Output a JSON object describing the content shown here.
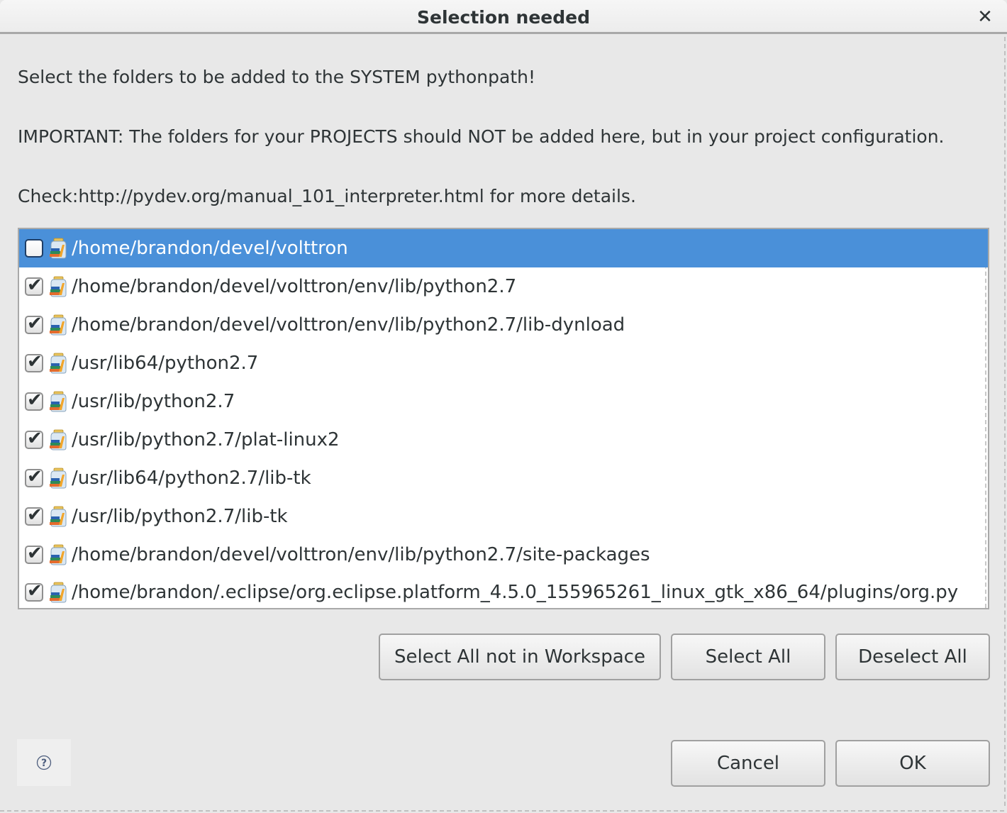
{
  "window": {
    "title": "Selection needed",
    "close_icon": "close-icon"
  },
  "messages": {
    "line1": "Select the folders to be added to the SYSTEM pythonpath!",
    "line2": "IMPORTANT: The folders for your PROJECTS should NOT be added here, but in your project configuration.",
    "line3": "Check:http://pydev.org/manual_101_interpreter.html for more details."
  },
  "folders": [
    {
      "path": "/home/brandon/devel/volttron",
      "checked": false,
      "selected": true
    },
    {
      "path": "/home/brandon/devel/volttron/env/lib/python2.7",
      "checked": true,
      "selected": false
    },
    {
      "path": "/home/brandon/devel/volttron/env/lib/python2.7/lib-dynload",
      "checked": true,
      "selected": false
    },
    {
      "path": "/usr/lib64/python2.7",
      "checked": true,
      "selected": false
    },
    {
      "path": "/usr/lib/python2.7",
      "checked": true,
      "selected": false
    },
    {
      "path": "/usr/lib/python2.7/plat-linux2",
      "checked": true,
      "selected": false
    },
    {
      "path": "/usr/lib64/python2.7/lib-tk",
      "checked": true,
      "selected": false
    },
    {
      "path": "/usr/lib/python2.7/lib-tk",
      "checked": true,
      "selected": false
    },
    {
      "path": "/home/brandon/devel/volttron/env/lib/python2.7/site-packages",
      "checked": true,
      "selected": false
    },
    {
      "path": "/home/brandon/.eclipse/org.eclipse.platform_4.5.0_155965261_linux_gtk_x86_64/plugins/org.py",
      "checked": true,
      "selected": false
    }
  ],
  "selection_buttons": {
    "select_not_in_workspace": "Select All not in Workspace",
    "select_all": "Select All",
    "deselect_all": "Deselect All"
  },
  "footer": {
    "help_icon": "help-icon",
    "cancel": "Cancel",
    "ok": "OK"
  },
  "colors": {
    "selection": "#4a90d9",
    "background": "#e8e8e8"
  }
}
